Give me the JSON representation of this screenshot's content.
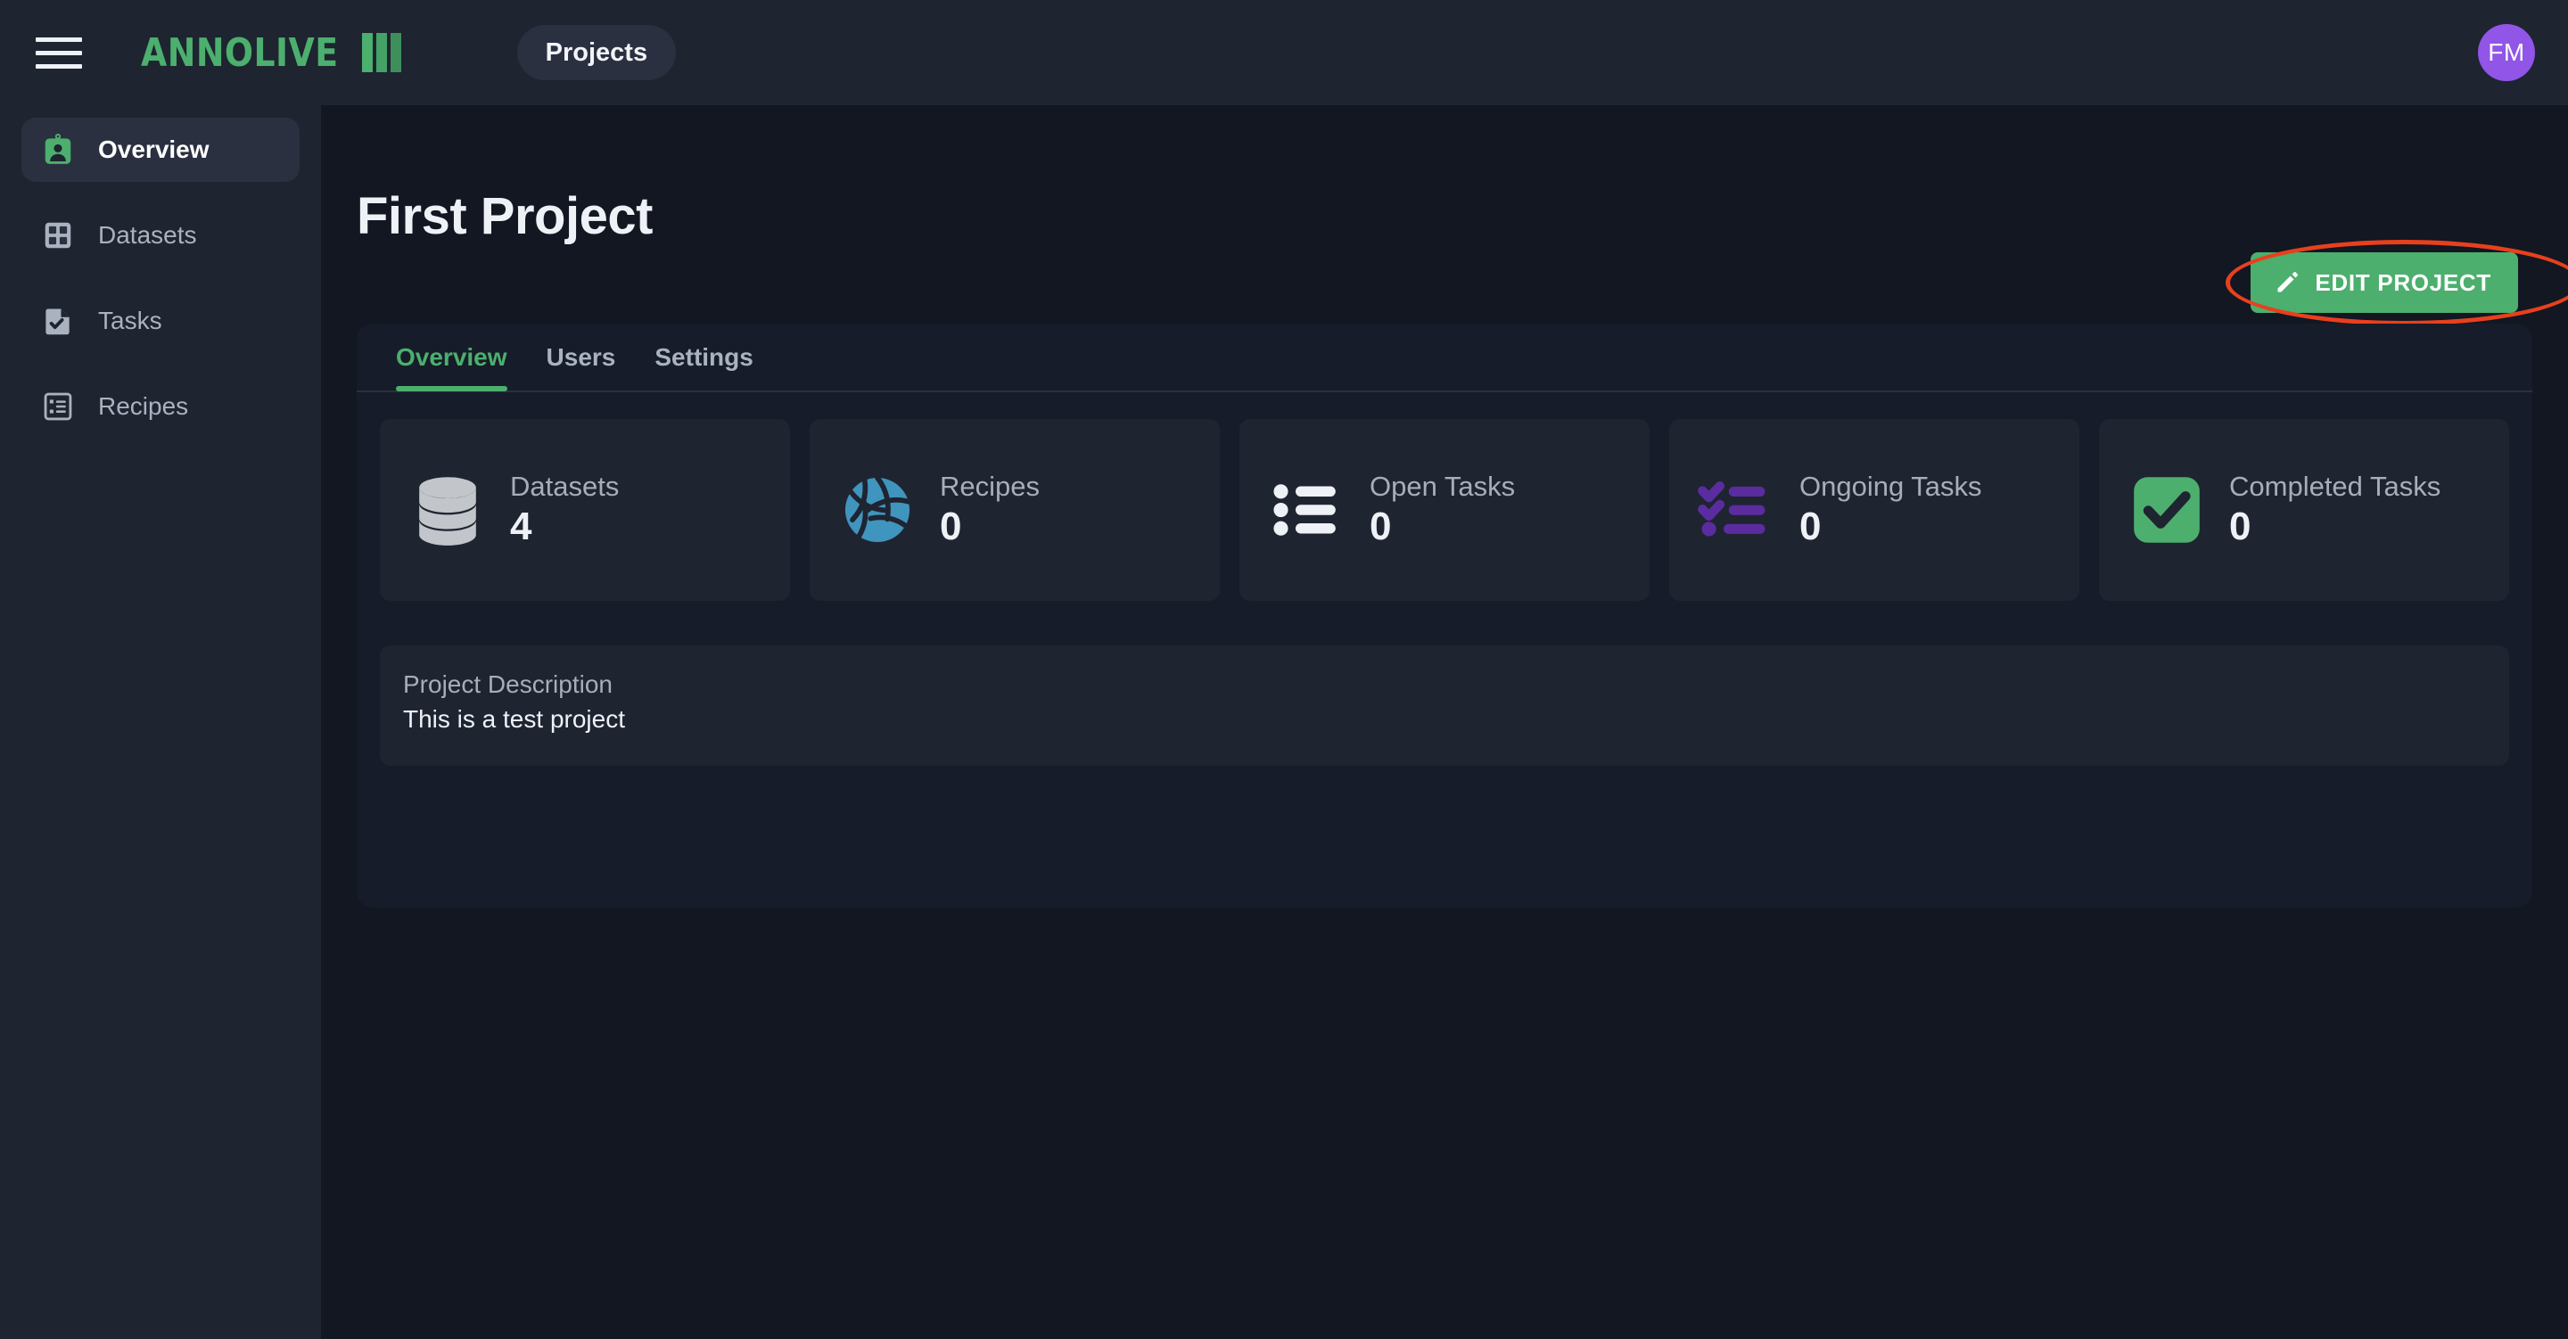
{
  "topbar": {
    "menu_icon": "hamburger-icon",
    "logo_text": "ANNOLIVE",
    "chip_label": "Projects",
    "avatar_initials": "FM"
  },
  "sidebar": {
    "items": [
      {
        "label": "Overview",
        "icon": "id-badge-icon",
        "active": true
      },
      {
        "label": "Datasets",
        "icon": "grid-icon",
        "active": false
      },
      {
        "label": "Tasks",
        "icon": "document-check-icon",
        "active": false
      },
      {
        "label": "Recipes",
        "icon": "list-icon",
        "active": false
      }
    ]
  },
  "main": {
    "page_title": "First Project",
    "edit_button": {
      "label": "EDIT PROJECT",
      "icon": "pencil-icon"
    },
    "tabs": [
      {
        "label": "Overview",
        "active": true
      },
      {
        "label": "Users",
        "active": false
      },
      {
        "label": "Settings",
        "active": false
      }
    ],
    "stats": [
      {
        "label": "Datasets",
        "value": "4",
        "icon": "database-icon"
      },
      {
        "label": "Recipes",
        "value": "0",
        "icon": "volleyball-icon"
      },
      {
        "label": "Open Tasks",
        "value": "0",
        "icon": "bulleted-list-icon"
      },
      {
        "label": "Ongoing Tasks",
        "value": "0",
        "icon": "checklist-icon"
      },
      {
        "label": "Completed Tasks",
        "value": "0",
        "icon": "check-square-icon"
      }
    ],
    "description": {
      "label": "Project Description",
      "value": "This is a test project"
    }
  },
  "annotation": {
    "shape": "ellipse-highlight",
    "color": "#e8401d",
    "target": "edit-project-button"
  },
  "colors": {
    "accent_green": "#4caf6e",
    "avatar_purple": "#9155e8",
    "annotation_red": "#e8401d",
    "recipes_blue": "#3f95bd",
    "ongoing_purple": "#5b2ca0",
    "page_bg": "#121722",
    "sidebar_bg": "#1e2430",
    "card_bg": "#1f2431"
  }
}
